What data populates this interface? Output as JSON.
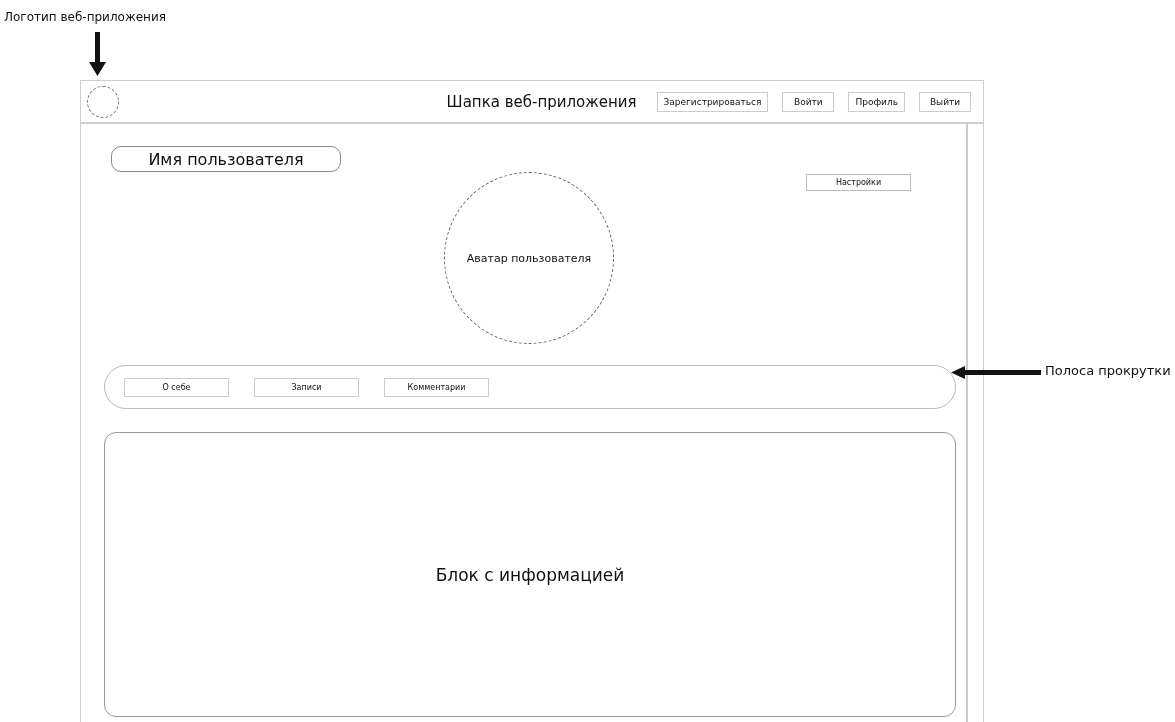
{
  "annotations": [
    {
      "text": "Логотип веб-приложения"
    },
    {
      "text": "Полоса прокрутки"
    }
  ],
  "header": {
    "title": "Шапка веб-приложения",
    "buttons": [
      "Зарегистрироваться",
      "Войти",
      "Профиль",
      "Выйти"
    ]
  },
  "profile": {
    "username": "Имя пользователя",
    "settings": "Настройки",
    "avatar": "Аватар пользователя"
  },
  "tabs": [
    {
      "label": "О себе"
    },
    {
      "label": "Записи"
    },
    {
      "label": "Комментарии"
    }
  ],
  "info_block": "Блок с информацией"
}
